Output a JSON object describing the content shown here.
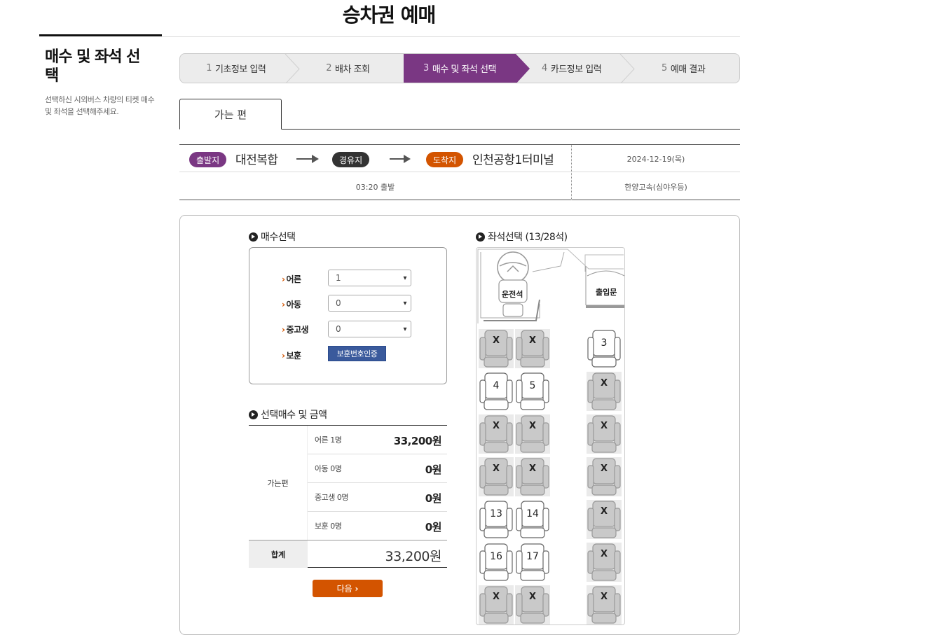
{
  "page_title": "승차권 예매",
  "side": {
    "title": "매수 및 좌석 선택",
    "desc": "선택하신 시외버스 차량의 티켓 매수 및 좌석을 선택해주세요."
  },
  "steps": [
    {
      "num": "1",
      "label": "기초정보 입력"
    },
    {
      "num": "2",
      "label": "배차 조회"
    },
    {
      "num": "3",
      "label": "매수 및 좌석 선택"
    },
    {
      "num": "4",
      "label": "카드정보 입력"
    },
    {
      "num": "5",
      "label": "예매 결과"
    }
  ],
  "tab": "가는 편",
  "route": {
    "dep_badge": "출발지",
    "dep_name": "대전복합",
    "via_badge": "경유지",
    "arr_badge": "도착지",
    "arr_name": "인천공항1터미널",
    "date": "2024-12-19(목)",
    "time": "03:20 출발",
    "company": "한양고속(심야우등)"
  },
  "count": {
    "title": "매수선택",
    "rows": [
      {
        "label": "어른",
        "value": "1"
      },
      {
        "label": "아동",
        "value": "0"
      },
      {
        "label": "중고생",
        "value": "0"
      }
    ],
    "veteran_label": "보훈",
    "veteran_button": "보훈번호인증"
  },
  "seat_title": "좌석선택 (13/28석)",
  "bus": {
    "driver": "운전석",
    "door": "출입문",
    "x_mark": "X",
    "seats": [
      {
        "col": 0,
        "row": 0,
        "label": "",
        "taken": true
      },
      {
        "col": 1,
        "row": 0,
        "label": "",
        "taken": true
      },
      {
        "col": 2,
        "row": 0,
        "label": "3",
        "taken": false
      },
      {
        "col": 0,
        "row": 1,
        "label": "4",
        "taken": false
      },
      {
        "col": 1,
        "row": 1,
        "label": "5",
        "taken": false
      },
      {
        "col": 2,
        "row": 1,
        "label": "",
        "taken": true
      },
      {
        "col": 0,
        "row": 2,
        "label": "",
        "taken": true
      },
      {
        "col": 1,
        "row": 2,
        "label": "",
        "taken": true
      },
      {
        "col": 2,
        "row": 2,
        "label": "",
        "taken": true
      },
      {
        "col": 0,
        "row": 3,
        "label": "",
        "taken": true
      },
      {
        "col": 1,
        "row": 3,
        "label": "",
        "taken": true
      },
      {
        "col": 2,
        "row": 3,
        "label": "",
        "taken": true
      },
      {
        "col": 0,
        "row": 4,
        "label": "13",
        "taken": false
      },
      {
        "col": 1,
        "row": 4,
        "label": "14",
        "taken": false
      },
      {
        "col": 2,
        "row": 4,
        "label": "",
        "taken": true
      },
      {
        "col": 0,
        "row": 5,
        "label": "16",
        "taken": false
      },
      {
        "col": 1,
        "row": 5,
        "label": "17",
        "taken": false
      },
      {
        "col": 2,
        "row": 5,
        "label": "",
        "taken": true
      },
      {
        "col": 0,
        "row": 6,
        "label": "",
        "taken": true
      },
      {
        "col": 1,
        "row": 6,
        "label": "",
        "taken": true
      },
      {
        "col": 2,
        "row": 6,
        "label": "",
        "taken": true
      }
    ]
  },
  "summary": {
    "title": "선택매수 및 금액",
    "direction": "가는편",
    "rows": [
      {
        "label": "어른 1명",
        "value": "33,200원"
      },
      {
        "label": "아동 0명",
        "value": "0원"
      },
      {
        "label": "중고생 0명",
        "value": "0원"
      },
      {
        "label": "보훈 0명",
        "value": "0원"
      }
    ],
    "total_label": "합계",
    "total_value": "33,200원"
  },
  "next_button": "다음",
  "colors": {
    "accent": "#7a3783",
    "orange": "#d35400",
    "blue": "#3a5a9c"
  }
}
